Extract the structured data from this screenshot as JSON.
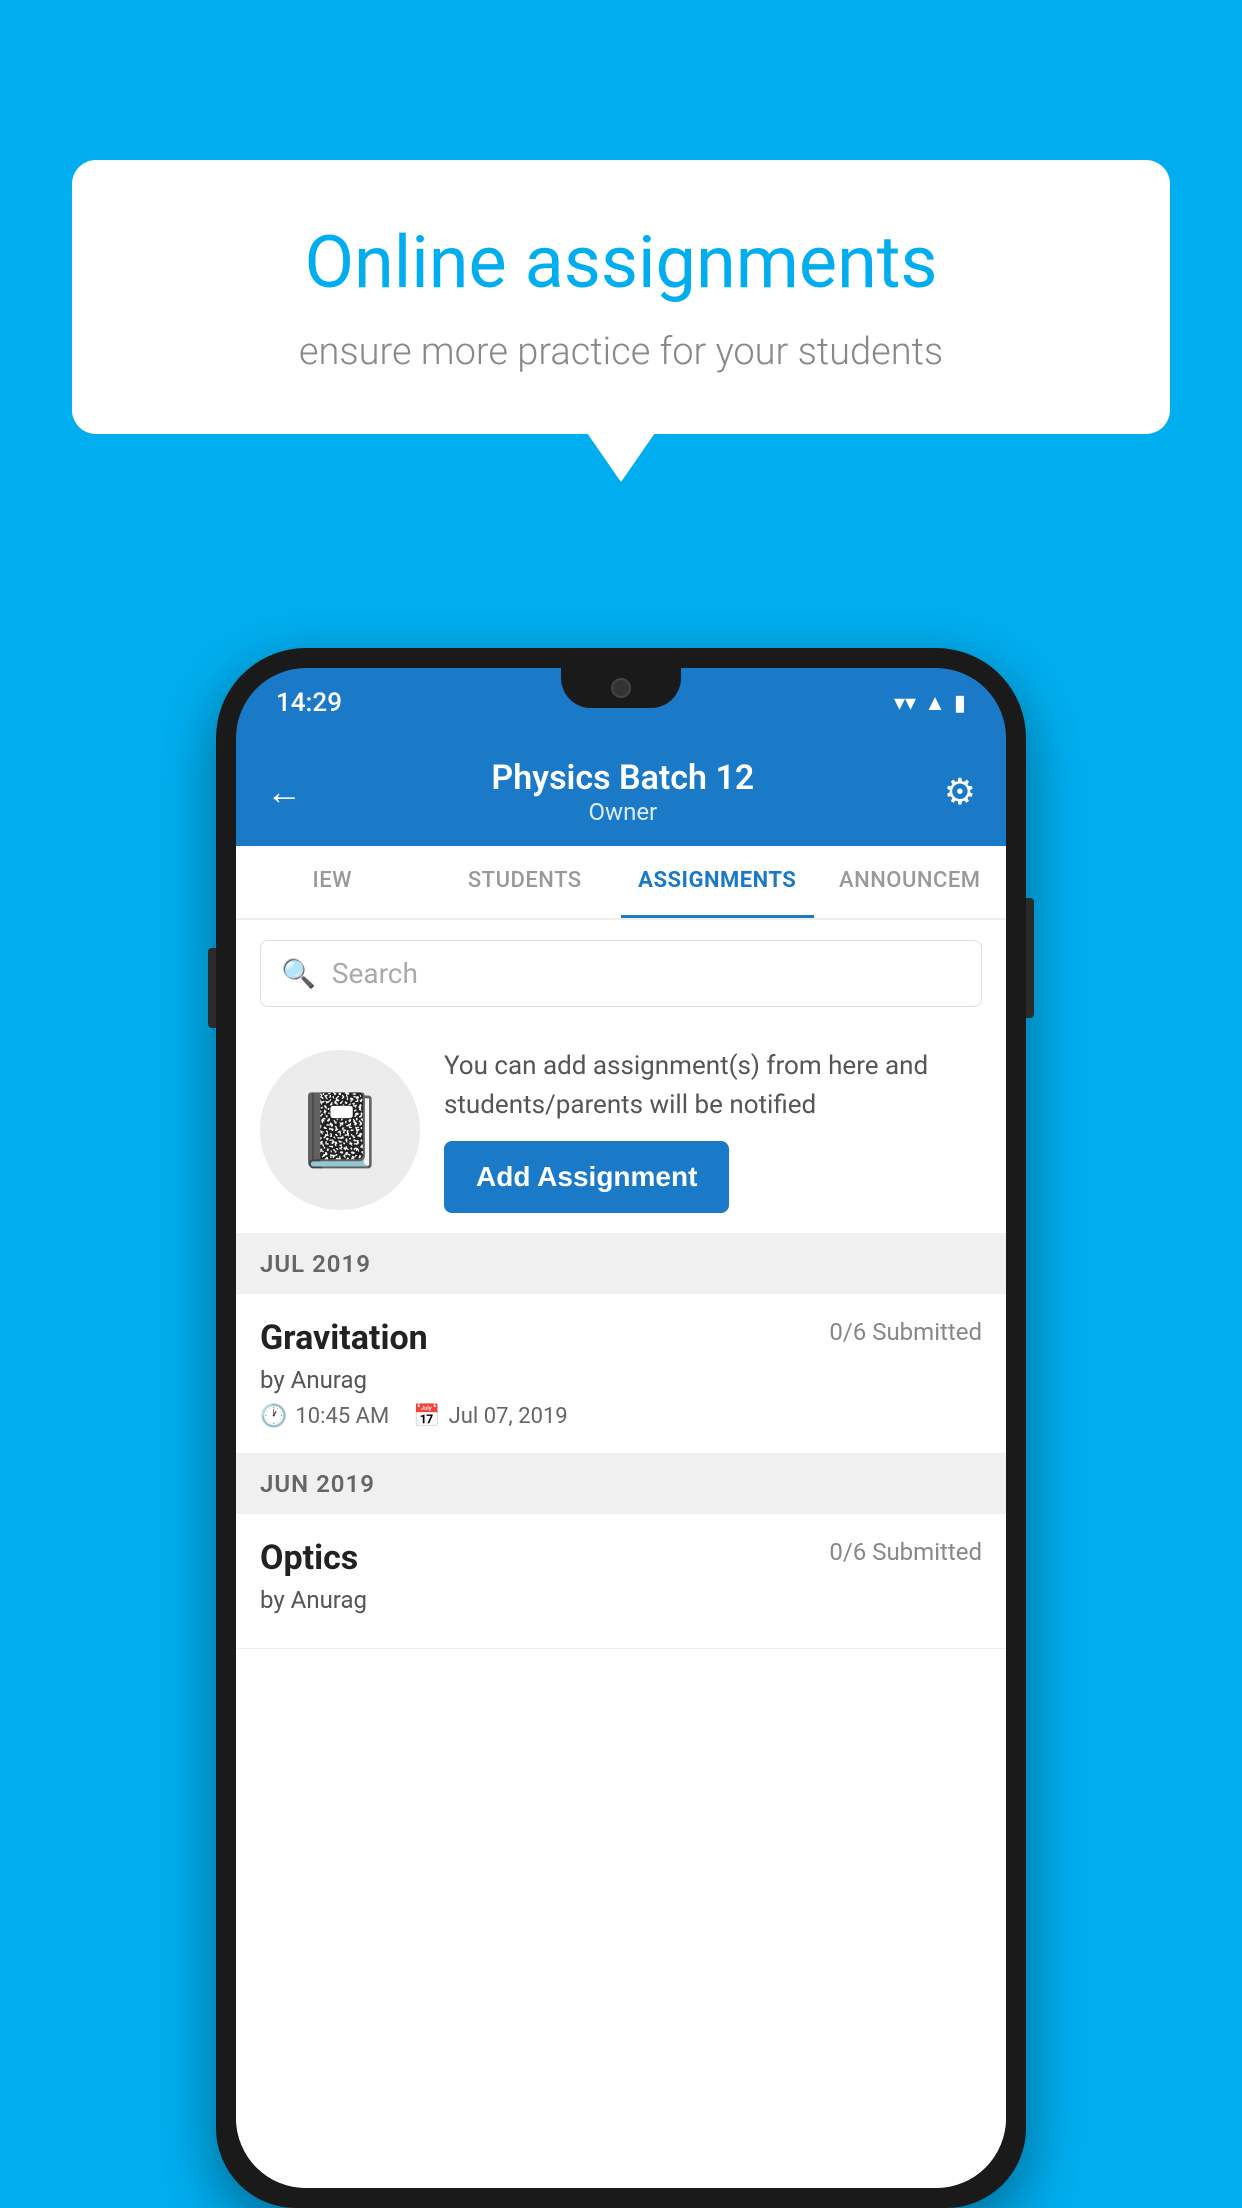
{
  "background_color": "#00AEEF",
  "speech_bubble": {
    "title": "Online assignments",
    "subtitle": "ensure more practice for your students"
  },
  "phone": {
    "status_bar": {
      "time": "14:29",
      "icons": [
        "wifi",
        "signal",
        "battery"
      ]
    },
    "header": {
      "title": "Physics Batch 12",
      "subtitle": "Owner",
      "back_label": "←",
      "settings_label": "⚙"
    },
    "tabs": [
      {
        "label": "IEW",
        "active": false
      },
      {
        "label": "STUDENTS",
        "active": false
      },
      {
        "label": "ASSIGNMENTS",
        "active": true
      },
      {
        "label": "ANNOUNCEM",
        "active": false
      }
    ],
    "search": {
      "placeholder": "Search"
    },
    "promo": {
      "text": "You can add assignment(s) from here and students/parents will be notified",
      "button_label": "Add Assignment"
    },
    "sections": [
      {
        "header": "JUL 2019",
        "assignments": [
          {
            "title": "Gravitation",
            "submitted": "0/6 Submitted",
            "by": "by Anurag",
            "time": "10:45 AM",
            "date": "Jul 07, 2019"
          }
        ]
      },
      {
        "header": "JUN 2019",
        "assignments": [
          {
            "title": "Optics",
            "submitted": "0/6 Submitted",
            "by": "by Anurag",
            "time": "",
            "date": ""
          }
        ]
      }
    ]
  }
}
